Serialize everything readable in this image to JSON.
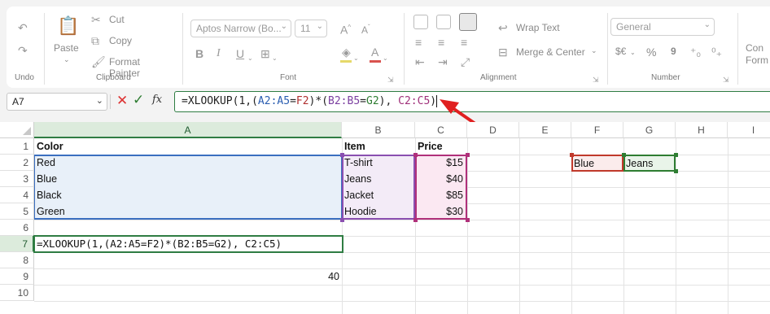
{
  "ribbon": {
    "undo_label": "Undo",
    "clipboard": {
      "paste_label": "Paste",
      "cut_label": "Cut",
      "copy_label": "Copy",
      "format_painter_label": "Format Painter",
      "group_label": "Clipboard"
    },
    "font": {
      "name": "Aptos Narrow (Bo...",
      "size": "11",
      "group_label": "Font"
    },
    "alignment": {
      "wrap_text_label": "Wrap Text",
      "merge_label": "Merge & Center",
      "group_label": "Alignment"
    },
    "number": {
      "format": "General",
      "currency_label": "$€",
      "percent_label": "%",
      "comma_label": "9",
      "group_label": "Number"
    },
    "cond_label": "Con Form"
  },
  "formula_bar": {
    "name_box": "A7",
    "fx_label": "fx",
    "formula": {
      "p1": "=XLOOKUP(1,(",
      "r1": "A2:A5",
      "p2": "=",
      "r2": "F2",
      "p3": ")*(",
      "r3": "B2:B5",
      "p4": "=",
      "r4": "G2",
      "p5": "), ",
      "r5": "C2:C5",
      "p6": ")"
    }
  },
  "grid": {
    "columns": [
      "A",
      "B",
      "C",
      "D",
      "E",
      "F",
      "G",
      "H",
      "I"
    ],
    "rows": [
      "1",
      "2",
      "3",
      "4",
      "5",
      "6",
      "7",
      "8",
      "9",
      "10"
    ],
    "headers": {
      "color": "Color",
      "item": "Item",
      "price": "Price"
    },
    "colors": [
      "Red",
      "Blue",
      "Black",
      "Green"
    ],
    "items": [
      "T-shirt",
      "Jeans",
      "Jacket",
      "Hoodie"
    ],
    "prices": [
      "$15",
      "$40",
      "$85",
      "$30"
    ],
    "f2": "Blue",
    "g2": "Jeans",
    "a7": "=XLOOKUP(1,(A2:A5=F2)*(B2:B5=G2), C2:C5)",
    "a9": "40"
  },
  "colors": {
    "accent_green": "#2f7d43",
    "range_blue": "#2a5db0",
    "range_purple": "#7b3fa0",
    "range_magenta": "#b0307a",
    "range_red": "#b03030",
    "arrow_red": "#e02020"
  }
}
